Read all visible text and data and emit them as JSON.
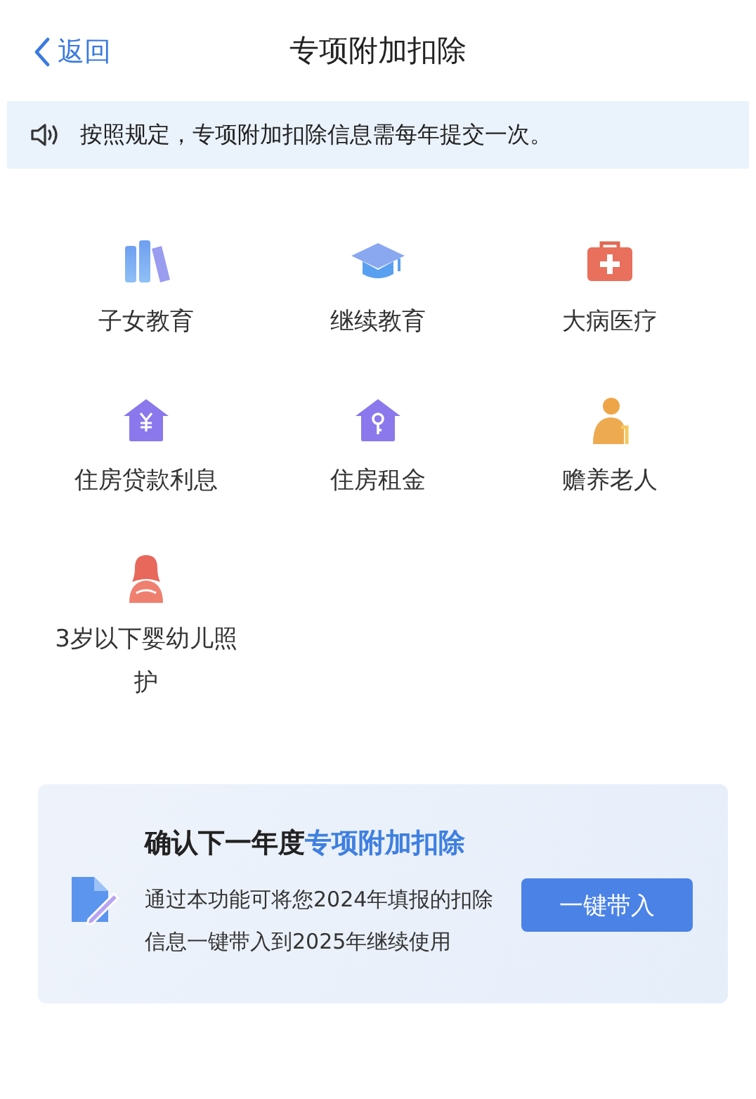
{
  "nav": {
    "back": "返回",
    "title": "专项附加扣除"
  },
  "notice": "按照规定，专项附加扣除信息需每年提交一次。",
  "items": [
    {
      "label": "子女教育",
      "kind": "books"
    },
    {
      "label": "继续教育",
      "kind": "cap"
    },
    {
      "label": "大病医疗",
      "kind": "medkit"
    },
    {
      "label": "住房贷款利息",
      "kind": "house-yen"
    },
    {
      "label": "住房租金",
      "kind": "house-key"
    },
    {
      "label": "赡养老人",
      "kind": "elder"
    },
    {
      "label": "3岁以下婴幼儿照护",
      "kind": "mother"
    }
  ],
  "card": {
    "title": "确认下一年度",
    "title_highlight": "专项附加扣除",
    "text": "通过本功能可将您2024年填报的扣除信息一键带入到2025年继续使用",
    "button": "一键带入"
  }
}
